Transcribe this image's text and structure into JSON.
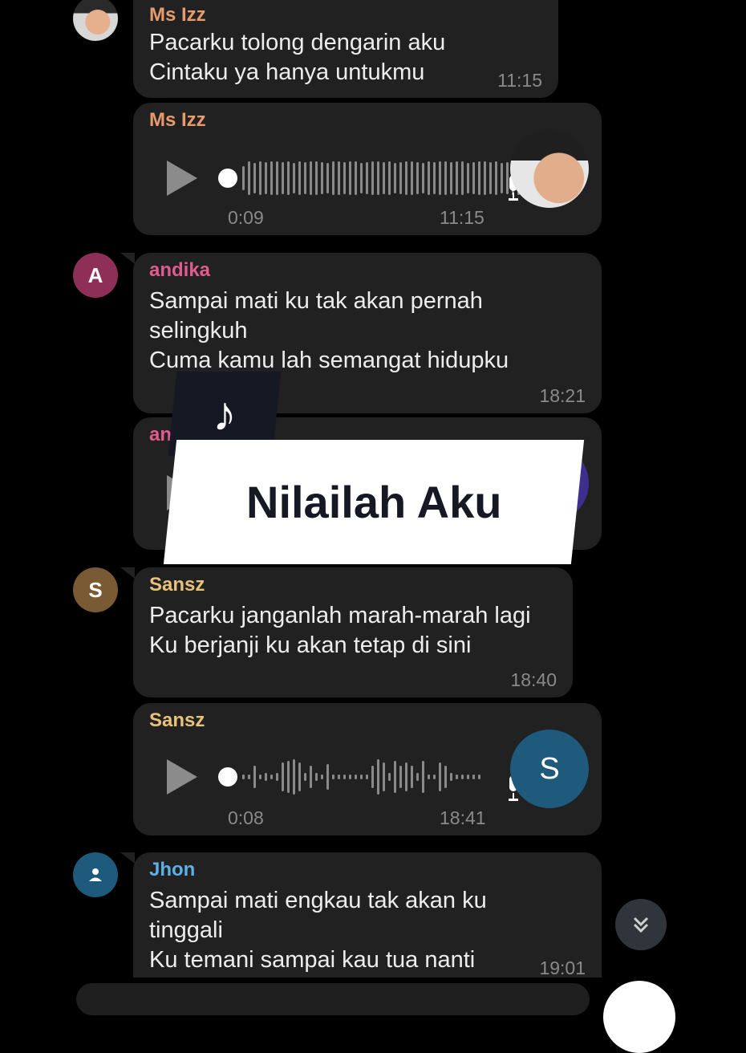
{
  "messages": [
    {
      "sender": "Ms Izz",
      "text": "Pacarku tolong dengarin aku\nCintaku ya hanya untukmu",
      "time": "11:15"
    },
    {
      "sender": "Ms Izz",
      "voice_duration": "0:09",
      "time": "11:15"
    },
    {
      "sender": "andika",
      "avatar_letter": "A",
      "text": "Sampai mati ku tak akan pernah\nselingkuh\nCuma kamu lah semangat hidupku",
      "time": "18:21"
    },
    {
      "sender": "an"
    },
    {
      "sender": "Sansz",
      "avatar_letter": "S",
      "text": "Pacarku janganlah marah-marah lagi\nKu berjanji ku akan tetap di sini",
      "time": "18:40"
    },
    {
      "sender": "Sansz",
      "avatar_letter": "S",
      "voice_duration": "0:08",
      "time": "18:41"
    },
    {
      "sender": "Jhon",
      "text": "Sampai mati engkau tak akan ku\ntinggali\nKu temani sampai kau tua nanti",
      "time": "19:01"
    }
  ],
  "overlay": {
    "title": "Nilailah Aku",
    "icon": "tiktok-note-icon"
  },
  "icons": {
    "play": "play-icon",
    "mic": "microphone-icon",
    "scroll": "double-chevron-down-icon",
    "person": "person-icon"
  },
  "colors": {
    "ms_izz_name": "#e89a6c",
    "andika_name": "#e05c8d",
    "andika_avatar": "#8e2f57",
    "sansz_name": "#e6c27a",
    "sansz_avatar": "#7a5a35",
    "sansz_voice_avatar": "#1e5a7c",
    "jhon_name": "#5ab0e8",
    "jhon_avatar": "#1e5a7c",
    "bubble": "#212121"
  }
}
